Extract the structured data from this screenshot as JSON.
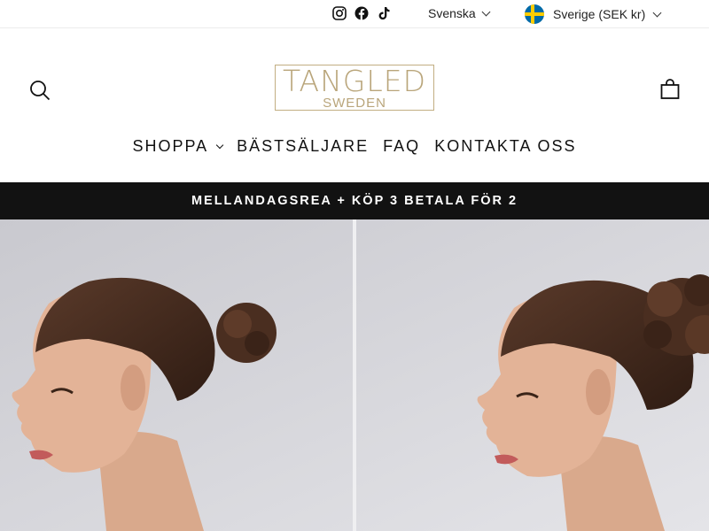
{
  "topbar": {
    "social": [
      {
        "icon": "instagram-icon"
      },
      {
        "icon": "facebook-icon"
      },
      {
        "icon": "tiktok-icon"
      }
    ],
    "language": "Svenska",
    "country": "Sverige (SEK kr)"
  },
  "header": {
    "logo_line1": "TANGLED",
    "logo_line2": "SWEDEN",
    "logo_color": "#b9a57a"
  },
  "nav": {
    "items": [
      "SHOPPA",
      "BÄSTSÄLJARE",
      "FAQ",
      "KONTAKTA OSS"
    ]
  },
  "announcement": {
    "text": "MELLANDAGSREA + KÖP 3 BETALA FÖR 2"
  },
  "colors": {
    "announcement_bg": "#121212",
    "hero_bg": "#d7d7db"
  }
}
